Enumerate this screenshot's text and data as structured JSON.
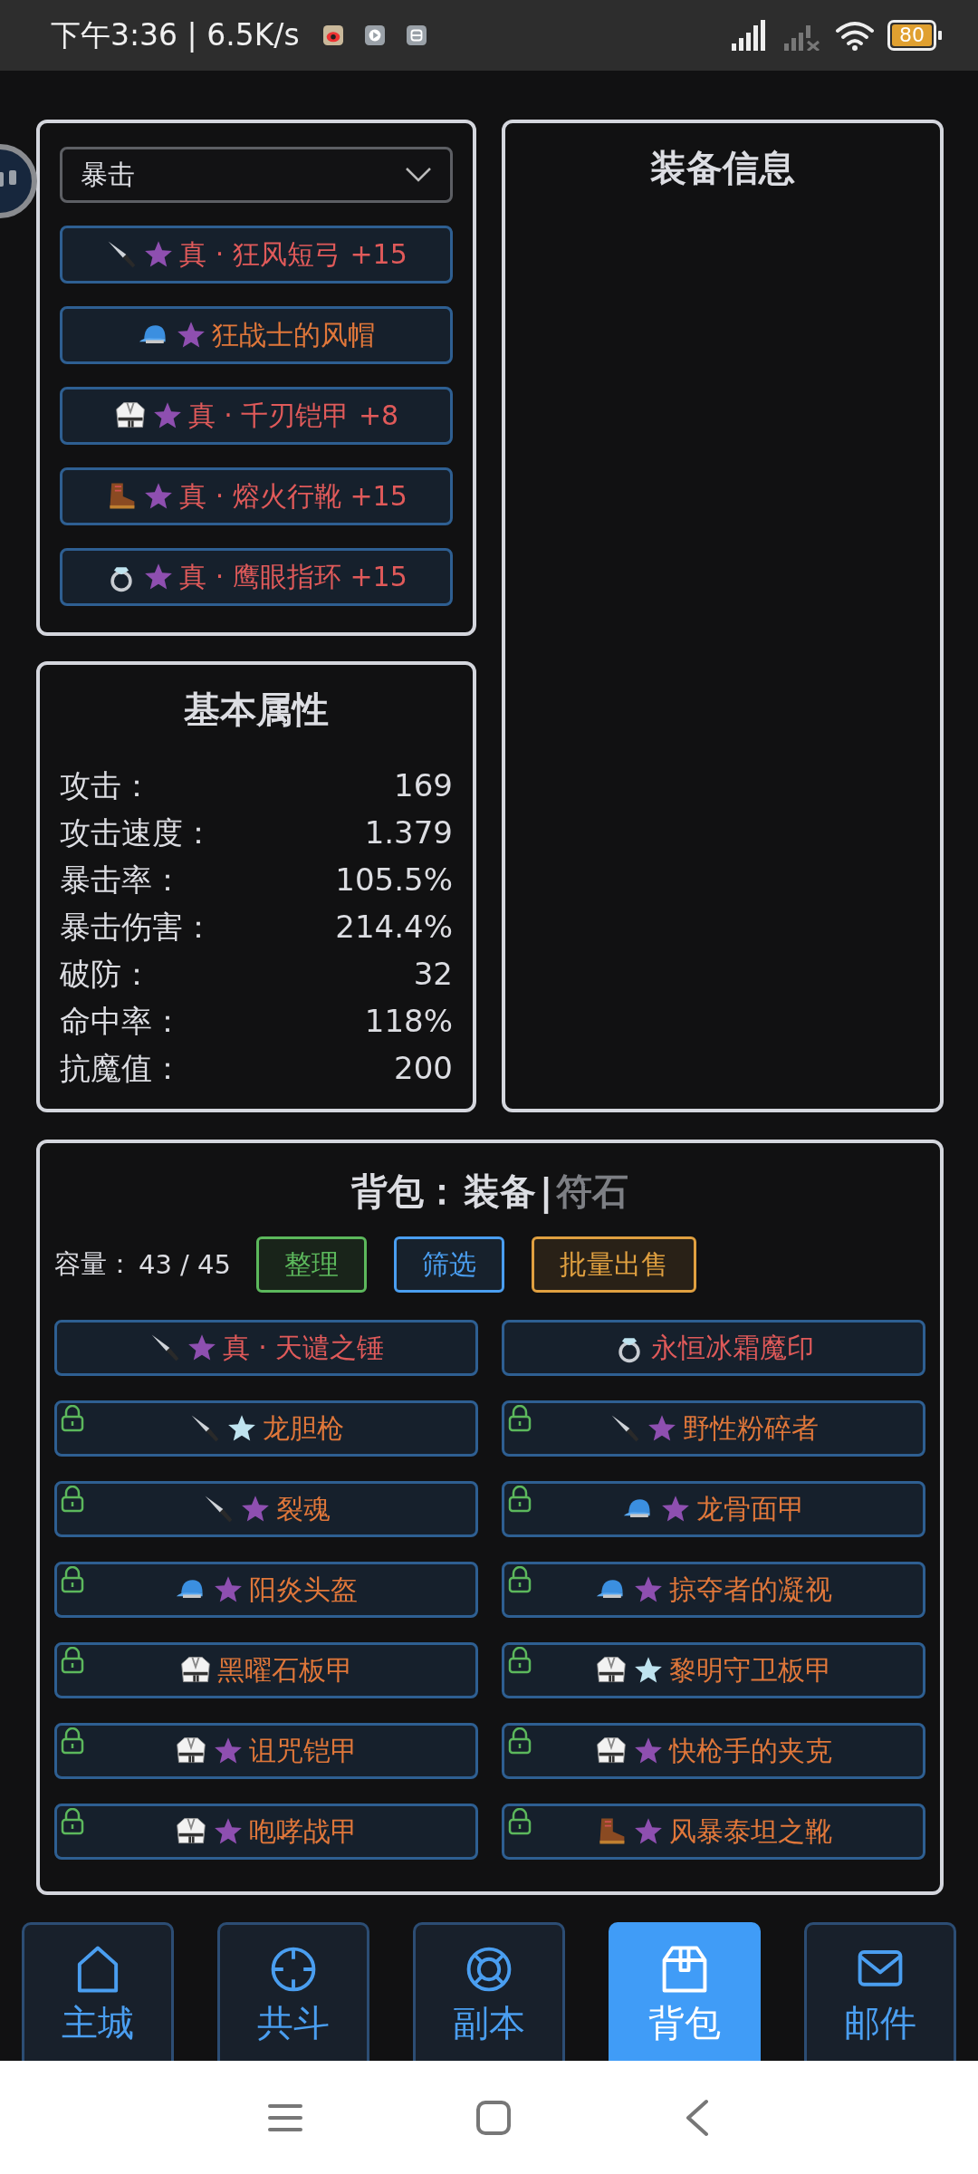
{
  "status_bar": {
    "time": "下午3:36 | 6.5K/s",
    "battery": "80"
  },
  "equip_panel": {
    "dropdown": {
      "value": "暴击"
    },
    "slots": [
      {
        "kind": "knife",
        "star": {
          "color": "#8e4fb0"
        },
        "name": "真 · 狂风短弓 +15",
        "color": "#e05a5a"
      },
      {
        "kind": "cap",
        "star": {
          "color": "#8e4fb0"
        },
        "name": "狂战士的风帽",
        "color": "#e0773a"
      },
      {
        "kind": "gi",
        "star": {
          "color": "#8e4fb0"
        },
        "name": "真 · 千刃铠甲 +8",
        "color": "#e05a5a"
      },
      {
        "kind": "boot",
        "star": {
          "color": "#8e4fb0"
        },
        "name": "真 · 熔火行靴 +15",
        "color": "#e05a5a"
      },
      {
        "kind": "ring",
        "star": {
          "color": "#8e4fb0"
        },
        "name": "真 · 鹰眼指环 +15",
        "color": "#e05a5a"
      }
    ]
  },
  "info_panel": {
    "title": "装备信息"
  },
  "stats_panel": {
    "title": "基本属性",
    "rows": [
      {
        "label": "攻击：",
        "value": "169"
      },
      {
        "label": "攻击速度：",
        "value": "1.379"
      },
      {
        "label": "暴击率：",
        "value": "105.5%"
      },
      {
        "label": "暴击伤害：",
        "value": "214.4%"
      },
      {
        "label": "破防：",
        "value": "32"
      },
      {
        "label": "命中率：",
        "value": "118%"
      },
      {
        "label": "抗魔值：",
        "value": "200"
      }
    ]
  },
  "bag": {
    "title": "背包：",
    "tabs": [
      {
        "label": "装备",
        "selected": true
      },
      {
        "label": "符石",
        "selected": false
      }
    ],
    "separator": "|",
    "capacity_label": "容量：",
    "capacity": "43 / 45",
    "buttons": [
      {
        "label": "整理",
        "color": "#5cb85c"
      },
      {
        "label": "筛选",
        "color": "#4a9ef0"
      },
      {
        "label": "批量出售",
        "color": "#e0a040"
      }
    ],
    "items": [
      {
        "kind": "knife",
        "star": {
          "color": "#8e4fb0"
        },
        "name": "真 · 天谴之锤",
        "color": "#e05a5a",
        "locked": false
      },
      {
        "kind": "ring",
        "name": "永恒冰霜魔印",
        "color": "#e05a5a",
        "locked": false
      },
      {
        "kind": "knife",
        "star": {
          "color": "#bfe3ef"
        },
        "name": "龙胆枪",
        "color": "#e0773a",
        "locked": true
      },
      {
        "kind": "knife",
        "star": {
          "color": "#8e4fb0"
        },
        "name": "野性粉碎者",
        "color": "#e0773a",
        "locked": true
      },
      {
        "kind": "knife",
        "star": {
          "color": "#8e4fb0"
        },
        "name": "裂魂",
        "color": "#e0773a",
        "locked": true
      },
      {
        "kind": "cap",
        "star": {
          "color": "#8e4fb0"
        },
        "name": "龙骨面甲",
        "color": "#e0773a",
        "locked": true
      },
      {
        "kind": "cap",
        "star": {
          "color": "#8e4fb0"
        },
        "name": "阳炎头盔",
        "color": "#e0773a",
        "locked": true
      },
      {
        "kind": "cap",
        "star": {
          "color": "#8e4fb0"
        },
        "name": "掠夺者的凝视",
        "color": "#e0773a",
        "locked": true
      },
      {
        "kind": "gi",
        "name": "黑曜石板甲",
        "color": "#e0773a",
        "locked": true
      },
      {
        "kind": "gi",
        "star": {
          "color": "#bfe3ef"
        },
        "name": "黎明守卫板甲",
        "color": "#e0773a",
        "locked": true
      },
      {
        "kind": "gi",
        "star": {
          "color": "#8e4fb0"
        },
        "name": "诅咒铠甲",
        "color": "#e0773a",
        "locked": true
      },
      {
        "kind": "gi",
        "star": {
          "color": "#8e4fb0"
        },
        "name": "快枪手的夹克",
        "color": "#e0773a",
        "locked": true
      },
      {
        "kind": "gi",
        "star": {
          "color": "#8e4fb0"
        },
        "name": "咆哮战甲",
        "color": "#e0773a",
        "locked": true
      },
      {
        "kind": "boot",
        "star": {
          "color": "#8e4fb0"
        },
        "name": "风暴泰坦之靴",
        "color": "#e0773a",
        "locked": true
      }
    ]
  },
  "nav": [
    {
      "kind": "home",
      "label": "主城",
      "selected": false
    },
    {
      "kind": "crosshair",
      "label": "共斗",
      "selected": false
    },
    {
      "kind": "lifebuoy",
      "label": "副本",
      "selected": false
    },
    {
      "kind": "box",
      "label": "背包",
      "selected": true
    },
    {
      "kind": "mail",
      "label": "邮件",
      "selected": false
    }
  ]
}
